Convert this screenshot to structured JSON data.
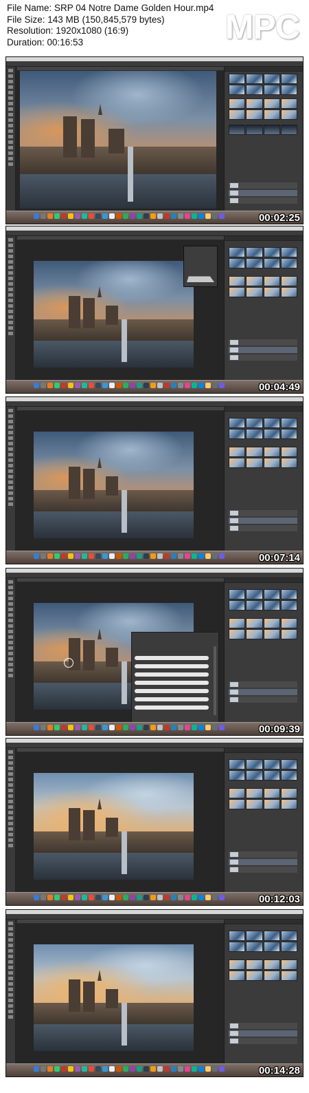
{
  "header": {
    "file_name_line": "File Name: SRP 04 Notre Dame Golden Hour.mp4",
    "file_size_line": "File Size: 143 MB (150,845,579 bytes)",
    "resolution_line": "Resolution: 1920x1080 (16:9)",
    "duration_line": "Duration: 00:16:53",
    "logo_text": "MPC"
  },
  "frames": [
    {
      "timestamp": "00:02:25",
      "variant": "overlay-panel"
    },
    {
      "timestamp": "00:04:49",
      "variant": "histogram"
    },
    {
      "timestamp": "00:07:14",
      "variant": "plain"
    },
    {
      "timestamp": "00:09:39",
      "variant": "brush-picker"
    },
    {
      "timestamp": "00:12:03",
      "variant": "warm"
    },
    {
      "timestamp": "00:14:28",
      "variant": "warm-final"
    }
  ],
  "colors": {
    "app_bg": "#2b2b2b",
    "panel_bg": "#3b3b3b",
    "dock": "#6a5a51"
  },
  "icons": [
    "photoshop-tools-icon",
    "dock-app-icon",
    "sky-preset-thumbnail-icon",
    "layer-thumbnail-icon"
  ]
}
